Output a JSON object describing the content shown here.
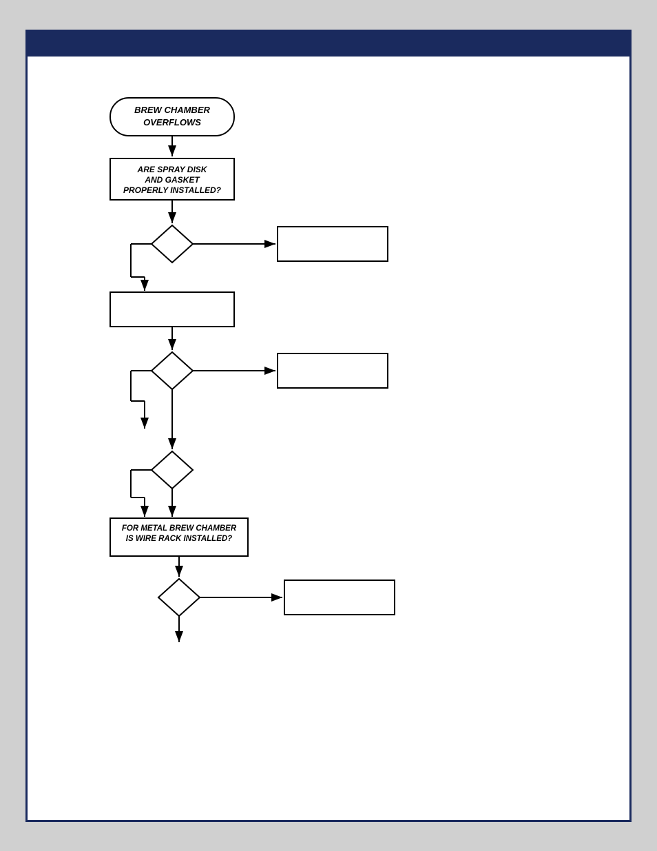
{
  "header": {
    "background_color": "#1a2a5e"
  },
  "flowchart": {
    "title": "BREW CHAMBER OVERFLOWS",
    "nodes": [
      {
        "id": "start",
        "type": "terminal",
        "text": "BREW CHAMBER\nOVERFLOWS"
      },
      {
        "id": "q1",
        "type": "process",
        "text": "ARE SPRAY DISK\nAND GASKET\nPROPERLY INSTALLED?"
      },
      {
        "id": "d1",
        "type": "diamond",
        "yes_label": "",
        "no_label": ""
      },
      {
        "id": "r1",
        "type": "rectangle",
        "text": ""
      },
      {
        "id": "p1",
        "type": "rectangle",
        "text": ""
      },
      {
        "id": "d2",
        "type": "diamond",
        "yes_label": "",
        "no_label": ""
      },
      {
        "id": "r2",
        "type": "rectangle",
        "text": ""
      },
      {
        "id": "d3",
        "type": "diamond",
        "yes_label": "",
        "no_label": ""
      },
      {
        "id": "q2",
        "type": "process",
        "text": "FOR METAL BREW CHAMBER\nIS WIRE RACK INSTALLED?"
      },
      {
        "id": "d4",
        "type": "diamond",
        "yes_label": "",
        "no_label": ""
      },
      {
        "id": "r3",
        "type": "rectangle",
        "text": ""
      }
    ]
  }
}
